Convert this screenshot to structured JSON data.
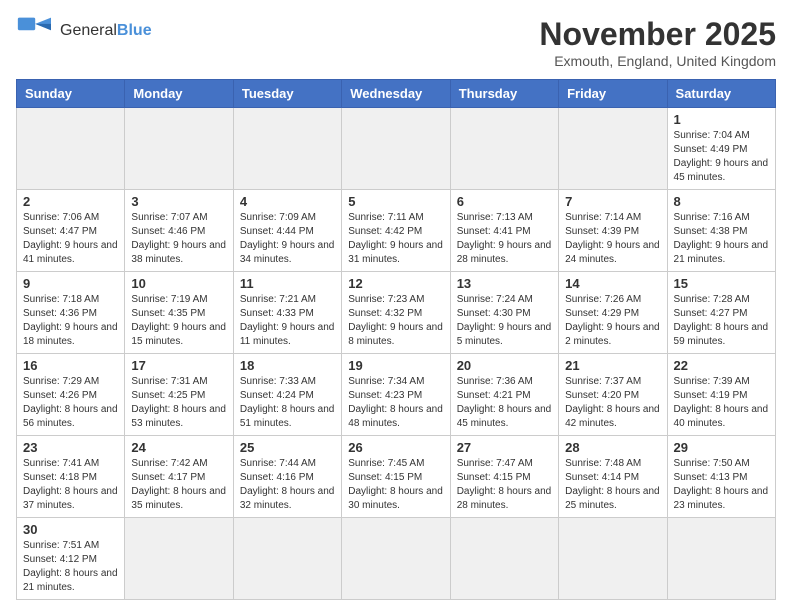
{
  "header": {
    "logo_general": "General",
    "logo_blue": "Blue",
    "month": "November 2025",
    "location": "Exmouth, England, United Kingdom"
  },
  "days_of_week": [
    "Sunday",
    "Monday",
    "Tuesday",
    "Wednesday",
    "Thursday",
    "Friday",
    "Saturday"
  ],
  "weeks": [
    [
      {
        "day": "",
        "info": ""
      },
      {
        "day": "",
        "info": ""
      },
      {
        "day": "",
        "info": ""
      },
      {
        "day": "",
        "info": ""
      },
      {
        "day": "",
        "info": ""
      },
      {
        "day": "",
        "info": ""
      },
      {
        "day": "1",
        "info": "Sunrise: 7:04 AM\nSunset: 4:49 PM\nDaylight: 9 hours and 45 minutes."
      }
    ],
    [
      {
        "day": "2",
        "info": "Sunrise: 7:06 AM\nSunset: 4:47 PM\nDaylight: 9 hours and 41 minutes."
      },
      {
        "day": "3",
        "info": "Sunrise: 7:07 AM\nSunset: 4:46 PM\nDaylight: 9 hours and 38 minutes."
      },
      {
        "day": "4",
        "info": "Sunrise: 7:09 AM\nSunset: 4:44 PM\nDaylight: 9 hours and 34 minutes."
      },
      {
        "day": "5",
        "info": "Sunrise: 7:11 AM\nSunset: 4:42 PM\nDaylight: 9 hours and 31 minutes."
      },
      {
        "day": "6",
        "info": "Sunrise: 7:13 AM\nSunset: 4:41 PM\nDaylight: 9 hours and 28 minutes."
      },
      {
        "day": "7",
        "info": "Sunrise: 7:14 AM\nSunset: 4:39 PM\nDaylight: 9 hours and 24 minutes."
      },
      {
        "day": "8",
        "info": "Sunrise: 7:16 AM\nSunset: 4:38 PM\nDaylight: 9 hours and 21 minutes."
      }
    ],
    [
      {
        "day": "9",
        "info": "Sunrise: 7:18 AM\nSunset: 4:36 PM\nDaylight: 9 hours and 18 minutes."
      },
      {
        "day": "10",
        "info": "Sunrise: 7:19 AM\nSunset: 4:35 PM\nDaylight: 9 hours and 15 minutes."
      },
      {
        "day": "11",
        "info": "Sunrise: 7:21 AM\nSunset: 4:33 PM\nDaylight: 9 hours and 11 minutes."
      },
      {
        "day": "12",
        "info": "Sunrise: 7:23 AM\nSunset: 4:32 PM\nDaylight: 9 hours and 8 minutes."
      },
      {
        "day": "13",
        "info": "Sunrise: 7:24 AM\nSunset: 4:30 PM\nDaylight: 9 hours and 5 minutes."
      },
      {
        "day": "14",
        "info": "Sunrise: 7:26 AM\nSunset: 4:29 PM\nDaylight: 9 hours and 2 minutes."
      },
      {
        "day": "15",
        "info": "Sunrise: 7:28 AM\nSunset: 4:27 PM\nDaylight: 8 hours and 59 minutes."
      }
    ],
    [
      {
        "day": "16",
        "info": "Sunrise: 7:29 AM\nSunset: 4:26 PM\nDaylight: 8 hours and 56 minutes."
      },
      {
        "day": "17",
        "info": "Sunrise: 7:31 AM\nSunset: 4:25 PM\nDaylight: 8 hours and 53 minutes."
      },
      {
        "day": "18",
        "info": "Sunrise: 7:33 AM\nSunset: 4:24 PM\nDaylight: 8 hours and 51 minutes."
      },
      {
        "day": "19",
        "info": "Sunrise: 7:34 AM\nSunset: 4:23 PM\nDaylight: 8 hours and 48 minutes."
      },
      {
        "day": "20",
        "info": "Sunrise: 7:36 AM\nSunset: 4:21 PM\nDaylight: 8 hours and 45 minutes."
      },
      {
        "day": "21",
        "info": "Sunrise: 7:37 AM\nSunset: 4:20 PM\nDaylight: 8 hours and 42 minutes."
      },
      {
        "day": "22",
        "info": "Sunrise: 7:39 AM\nSunset: 4:19 PM\nDaylight: 8 hours and 40 minutes."
      }
    ],
    [
      {
        "day": "23",
        "info": "Sunrise: 7:41 AM\nSunset: 4:18 PM\nDaylight: 8 hours and 37 minutes."
      },
      {
        "day": "24",
        "info": "Sunrise: 7:42 AM\nSunset: 4:17 PM\nDaylight: 8 hours and 35 minutes."
      },
      {
        "day": "25",
        "info": "Sunrise: 7:44 AM\nSunset: 4:16 PM\nDaylight: 8 hours and 32 minutes."
      },
      {
        "day": "26",
        "info": "Sunrise: 7:45 AM\nSunset: 4:15 PM\nDaylight: 8 hours and 30 minutes."
      },
      {
        "day": "27",
        "info": "Sunrise: 7:47 AM\nSunset: 4:15 PM\nDaylight: 8 hours and 28 minutes."
      },
      {
        "day": "28",
        "info": "Sunrise: 7:48 AM\nSunset: 4:14 PM\nDaylight: 8 hours and 25 minutes."
      },
      {
        "day": "29",
        "info": "Sunrise: 7:50 AM\nSunset: 4:13 PM\nDaylight: 8 hours and 23 minutes."
      }
    ],
    [
      {
        "day": "30",
        "info": "Sunrise: 7:51 AM\nSunset: 4:12 PM\nDaylight: 8 hours and 21 minutes."
      },
      {
        "day": "",
        "info": ""
      },
      {
        "day": "",
        "info": ""
      },
      {
        "day": "",
        "info": ""
      },
      {
        "day": "",
        "info": ""
      },
      {
        "day": "",
        "info": ""
      },
      {
        "day": "",
        "info": ""
      }
    ]
  ]
}
